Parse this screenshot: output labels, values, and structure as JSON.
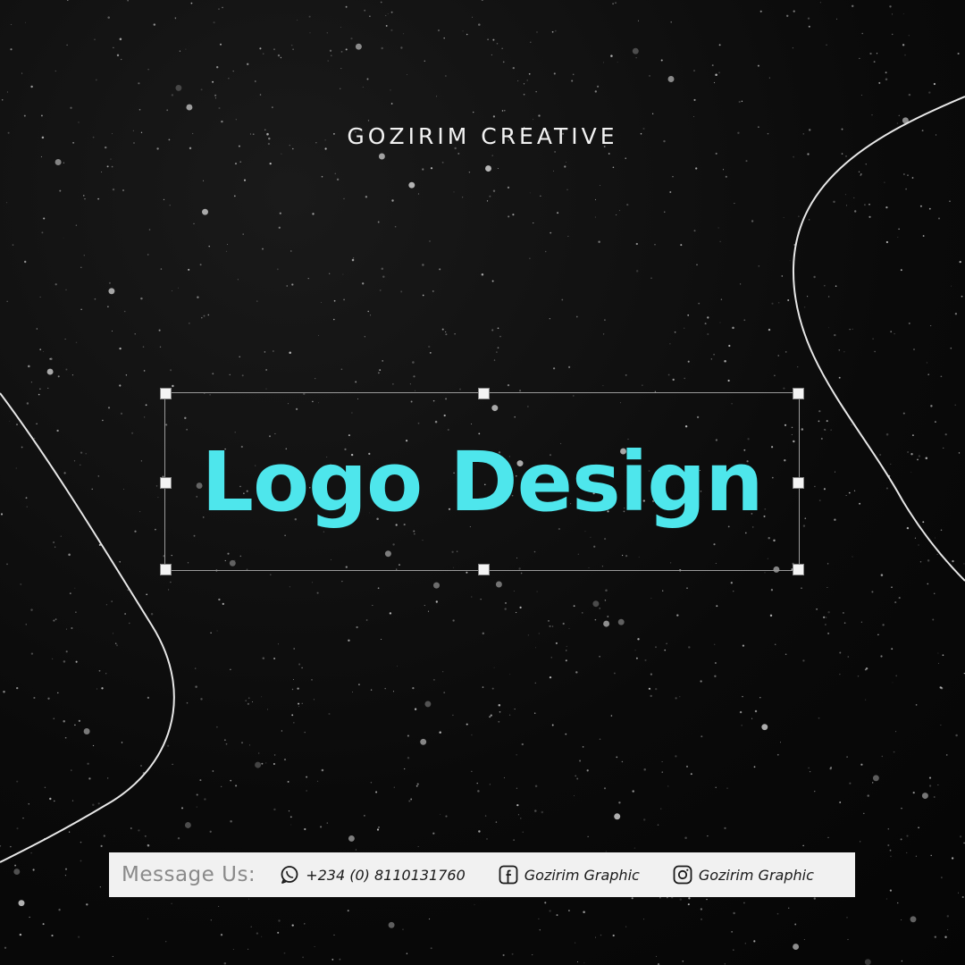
{
  "header": {
    "brand": "GOZIRIM CREATIVE"
  },
  "hero": {
    "headline": "Logo Design"
  },
  "contact": {
    "label": "Message Us:",
    "items": [
      {
        "icon": "whatsapp-icon",
        "text": "+234 (0) 8110131760"
      },
      {
        "icon": "facebook-icon",
        "text": "Gozirim Graphic"
      },
      {
        "icon": "instagram-icon",
        "text": "Gozirim Graphic"
      }
    ]
  },
  "colors": {
    "background": "#0b0b0b",
    "headline": "#4ee6ec",
    "brand_text": "#f2f2f2",
    "contact_bar": "#f1f1f1"
  }
}
